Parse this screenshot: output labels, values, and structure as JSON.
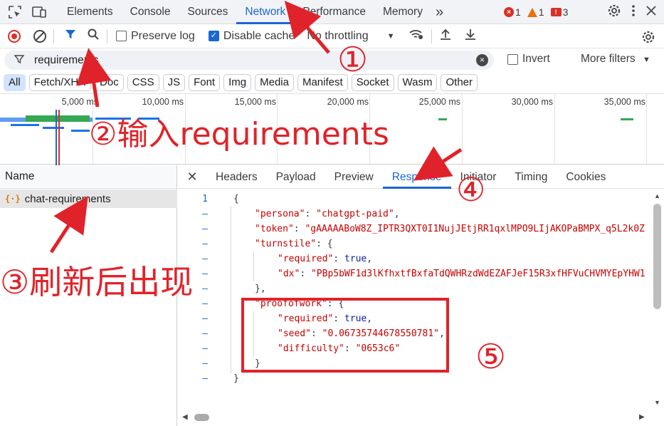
{
  "topbar": {
    "tabs": [
      "Elements",
      "Console",
      "Sources",
      "Network",
      "Performance",
      "Memory"
    ],
    "more": "»",
    "errors": "1",
    "warnings": "1",
    "issues": "3"
  },
  "toolbar": {
    "preserve_log": "Preserve log",
    "preserve_checked": false,
    "disable_cache": "Disable cache",
    "disable_checked": true,
    "throttling": "No throttling"
  },
  "filter": {
    "value": "requirements",
    "invert": "Invert",
    "more_filters": "More filters"
  },
  "chips": [
    "All",
    "Fetch/XHR",
    "Doc",
    "CSS",
    "JS",
    "Font",
    "Img",
    "Media",
    "Manifest",
    "Socket",
    "Wasm",
    "Other"
  ],
  "overview": {
    "ticks": [
      "5,000 ms",
      "10,000 ms",
      "15,000 ms",
      "20,000 ms",
      "25,000 ms",
      "30,000 ms",
      "35,000 ms"
    ]
  },
  "requests": {
    "header": "Name",
    "items": [
      "chat-requirements"
    ]
  },
  "detail": {
    "tabs": [
      "Headers",
      "Payload",
      "Preview",
      "Response",
      "Initiator",
      "Timing",
      "Cookies"
    ],
    "active": "Response"
  },
  "response": {
    "line_number": "1",
    "persona": "chatgpt-paid",
    "token": "gAAAAABoW8Z_IPTR3QXT0I1NujJEtjRR1qxlMPO9LIjAKOPaBMPX_q5L2k0Z",
    "turnstile_required": "true",
    "dx": "PBp5bWF1d3lKfhxtfBxfaTdQWHRzdWdEZAFJeF15R3xfHFVuCHVMYEpYHW1",
    "pow_required": "true",
    "seed": "0.06735744678550781",
    "difficulty": "0653c6"
  },
  "annotations": {
    "a1": "①",
    "a2": "②输入requirements",
    "a3": "③刷新后出现",
    "a4": "④",
    "a5": "⑤"
  }
}
